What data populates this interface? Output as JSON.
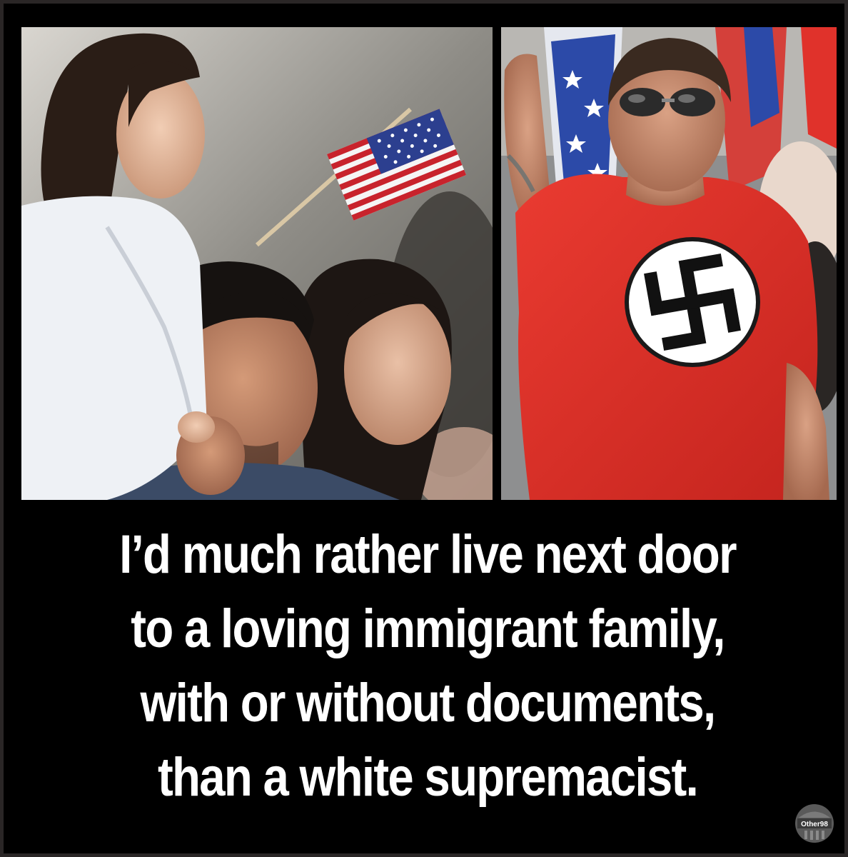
{
  "caption": {
    "lines": [
      "I’d much rather live next door",
      "to a loving immigrant family,",
      "with or without documents,",
      "than a white supremacist."
    ]
  },
  "watermark": {
    "text": "Other98"
  },
  "photos": {
    "left": {
      "icon": "us-flag-icon"
    },
    "right": {
      "icon": "swastika-armband-icon"
    }
  },
  "colors": {
    "background": "#000000",
    "caption_text": "#ffffff",
    "shirt_red": "#e0322b",
    "flag_red": "#c8232c",
    "flag_blue": "#2c3f8f"
  }
}
